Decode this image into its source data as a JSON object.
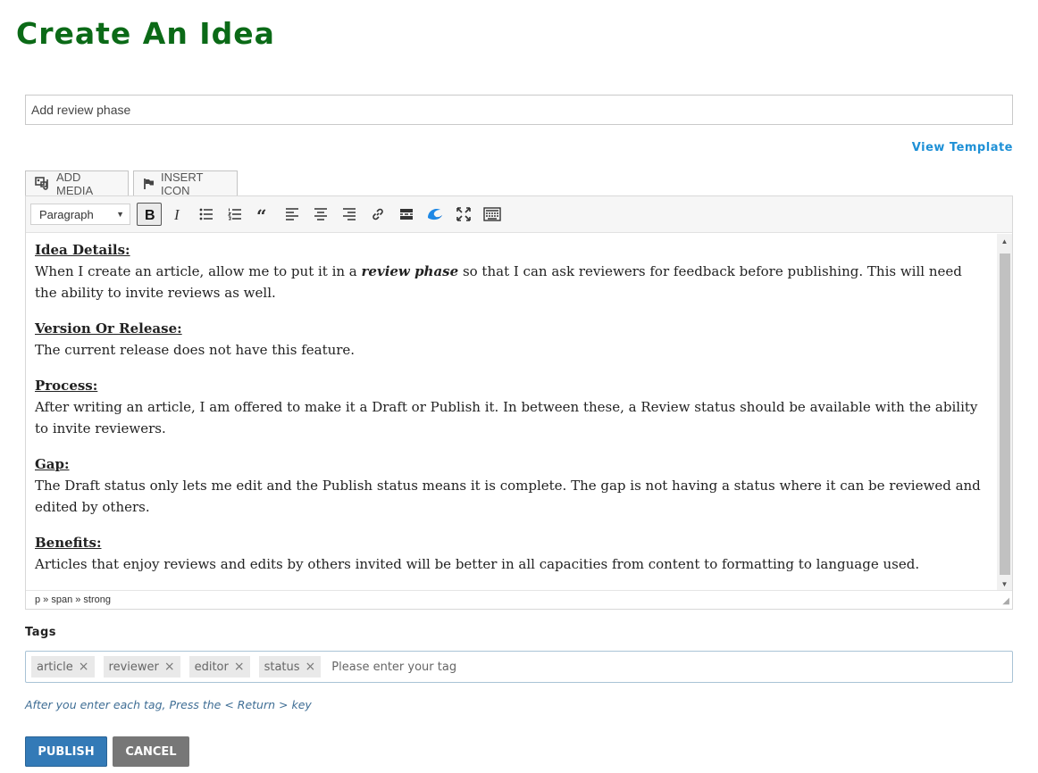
{
  "page": {
    "title": "Create An Idea"
  },
  "title_field": {
    "value": "Add review phase"
  },
  "view_template_label": "View Template",
  "media_buttons": {
    "add_media": "ADD MEDIA",
    "insert_icon": "INSERT ICON"
  },
  "toolbar": {
    "format_select": "Paragraph",
    "buttons": [
      "bold-icon",
      "italic-icon",
      "bullet-list-icon",
      "numbered-list-icon",
      "blockquote-icon",
      "align-left-icon",
      "align-center-icon",
      "align-right-icon",
      "link-icon",
      "read-more-icon",
      "wordpress-icon",
      "fullscreen-icon",
      "keyboard-icon"
    ]
  },
  "content": {
    "sections": [
      {
        "heading": "Idea Details:",
        "before": "When I create an article, allow me to put it in a ",
        "emphasis": "review phase",
        "after": " so that I can ask reviewers for feedback before publishing. This will need the ability to invite reviews as well."
      },
      {
        "heading": "Version Or Release:",
        "text": "The current release does not have this feature."
      },
      {
        "heading": "Process:",
        "text": "After writing an article, I am offered to make it a Draft or Publish it. In between these, a Review status should be available with the ability to invite reviewers."
      },
      {
        "heading": "Gap:",
        "text": "The Draft status only lets me edit and the Publish status means it is complete. The gap is not having a status where it can be reviewed and edited by others."
      },
      {
        "heading": "Benefits:",
        "text": "Articles that enjoy reviews and edits by others invited will be better in all capacities from content to formatting to language used."
      }
    ]
  },
  "status_path": "p » span » strong",
  "tags": {
    "label": "Tags",
    "items": [
      "article",
      "reviewer",
      "editor",
      "status"
    ],
    "remove_glyph": "×",
    "placeholder": "Please enter your tag",
    "hint": "After you enter each tag, Press the < Return > key"
  },
  "actions": {
    "publish": "PUBLISH",
    "cancel": "CANCEL"
  },
  "colors": {
    "title": "#0b6a17",
    "link": "#1e90d6",
    "publish": "#337ab7",
    "cancel": "#777777",
    "hint": "#3f6e95"
  }
}
